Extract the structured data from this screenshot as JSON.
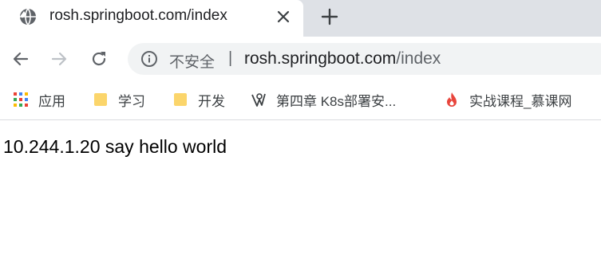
{
  "tab": {
    "title": "rosh.springboot.com/index",
    "favicon_icon": "globe-icon",
    "close_icon": "close-icon"
  },
  "new_tab_icon": "plus-icon",
  "toolbar": {
    "back_icon": "arrow-left-icon",
    "forward_icon": "arrow-right-icon",
    "reload_icon": "reload-icon",
    "security_icon": "info-icon",
    "security_label": "不安全",
    "url_host": "rosh.springboot.com",
    "url_path": "/index"
  },
  "bookmarks": [
    {
      "label": "应用",
      "icon": "apps-grid-icon"
    },
    {
      "label": "学习",
      "icon": "folder-icon"
    },
    {
      "label": "开发",
      "icon": "folder-icon"
    },
    {
      "label": "第四章 K8s部署安...",
      "icon": "site-logo-icon"
    },
    {
      "label": "实战课程_慕课网",
      "icon": "flame-icon"
    }
  ],
  "page": {
    "text": "10.244.1.20 say hello world"
  },
  "colors": {
    "tab_strip": "#dee1e6",
    "omnibox": "#f1f3f4",
    "folder": "#fbd56b",
    "flame": "#e8453c"
  }
}
